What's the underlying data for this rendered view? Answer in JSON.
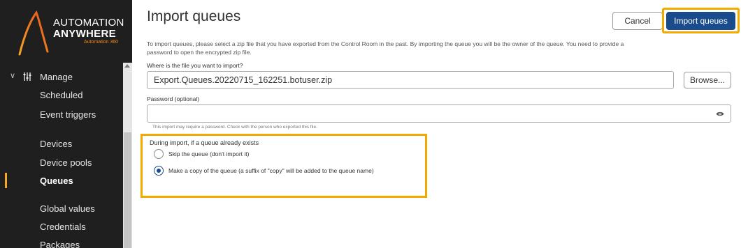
{
  "brand": {
    "line1": "AUTOMATION",
    "line2": "ANYWHERE",
    "line3": "Automation 360",
    "accent_color": "#f28a1b"
  },
  "sidebar": {
    "section_label": "Manage",
    "items": [
      {
        "label": "Scheduled"
      },
      {
        "label": "Event triggers"
      },
      {
        "label": "Devices"
      },
      {
        "label": "Device pools"
      },
      {
        "label": "Queues",
        "active": true
      },
      {
        "label": "Global values"
      },
      {
        "label": "Credentials"
      },
      {
        "label": "Packages"
      }
    ]
  },
  "page": {
    "title": "Import queues",
    "cancel_label": "Cancel",
    "import_label": "Import queues",
    "intro": "To import queues, please select a zip file that you have exported from the Control Room in the past. By importing the queue you will be the owner of the queue. You need to provide a password to open the encrypted zip file."
  },
  "form": {
    "file_label": "Where is the file you want to import?",
    "file_value": "Export.Queues.20220715_162251.botuser.zip",
    "browse_label": "Browse...",
    "password_label": "Password (optional)",
    "password_value": "",
    "password_hint": "This import may require a password. Check with the person who exported this file.",
    "exists_title": "During import, if a queue already exists",
    "options": [
      {
        "label": "Skip the queue (don't import it)",
        "selected": false
      },
      {
        "label": "Make a copy of the queue (a suffix of \"copy\" will be added to the queue name)",
        "selected": true
      }
    ]
  },
  "colors": {
    "sidebar_bg": "#1f1f1f",
    "primary_button": "#1a4b8c",
    "highlight": "#f2a900"
  }
}
